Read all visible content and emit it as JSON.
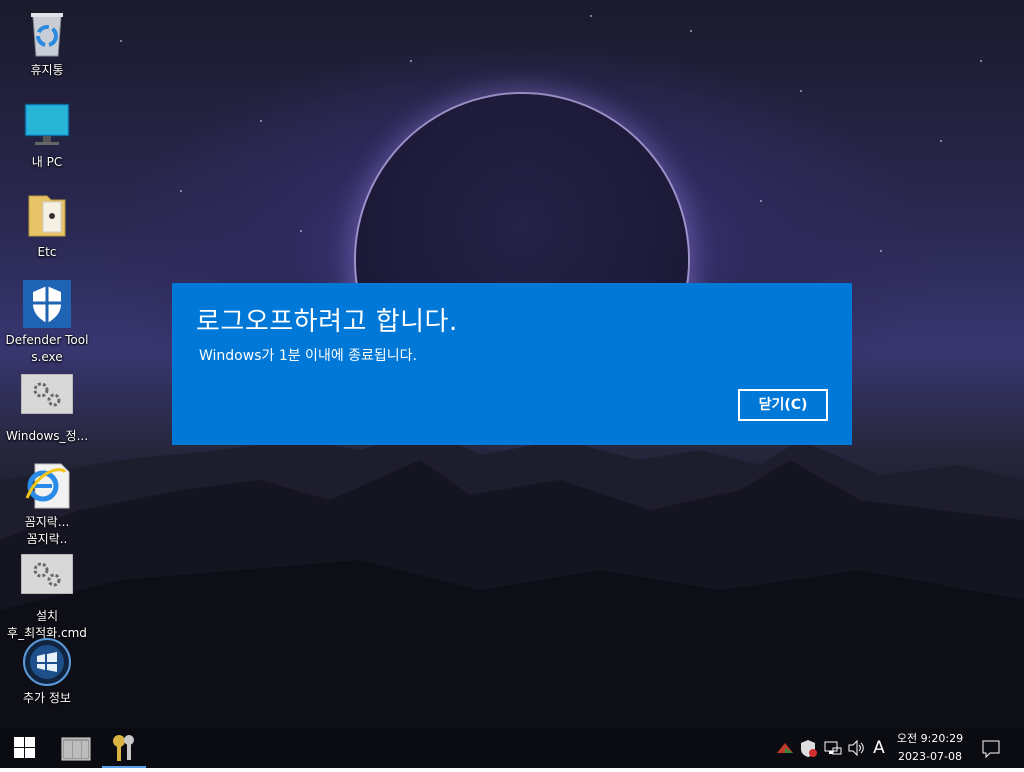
{
  "desktop_icons": [
    {
      "label": "휴지통"
    },
    {
      "label": "내 PC"
    },
    {
      "label": "Etc"
    },
    {
      "label": "Defender Tools.exe"
    },
    {
      "label": "Windows_정..."
    },
    {
      "label": "꼼지락...\n꼼지락.."
    },
    {
      "label": "설치\n후_최적화.cmd"
    },
    {
      "label": "추가 정보"
    }
  ],
  "dialog": {
    "title": "로그오프하려고 합니다.",
    "message": "Windows가 1분 이내에 종료됩니다.",
    "close_label": "닫기(C)",
    "color": "#0078d7"
  },
  "taskbar": {
    "tray_ime": "A",
    "clock_time": "오전 9:20:29",
    "clock_date": "2023-07-08"
  }
}
